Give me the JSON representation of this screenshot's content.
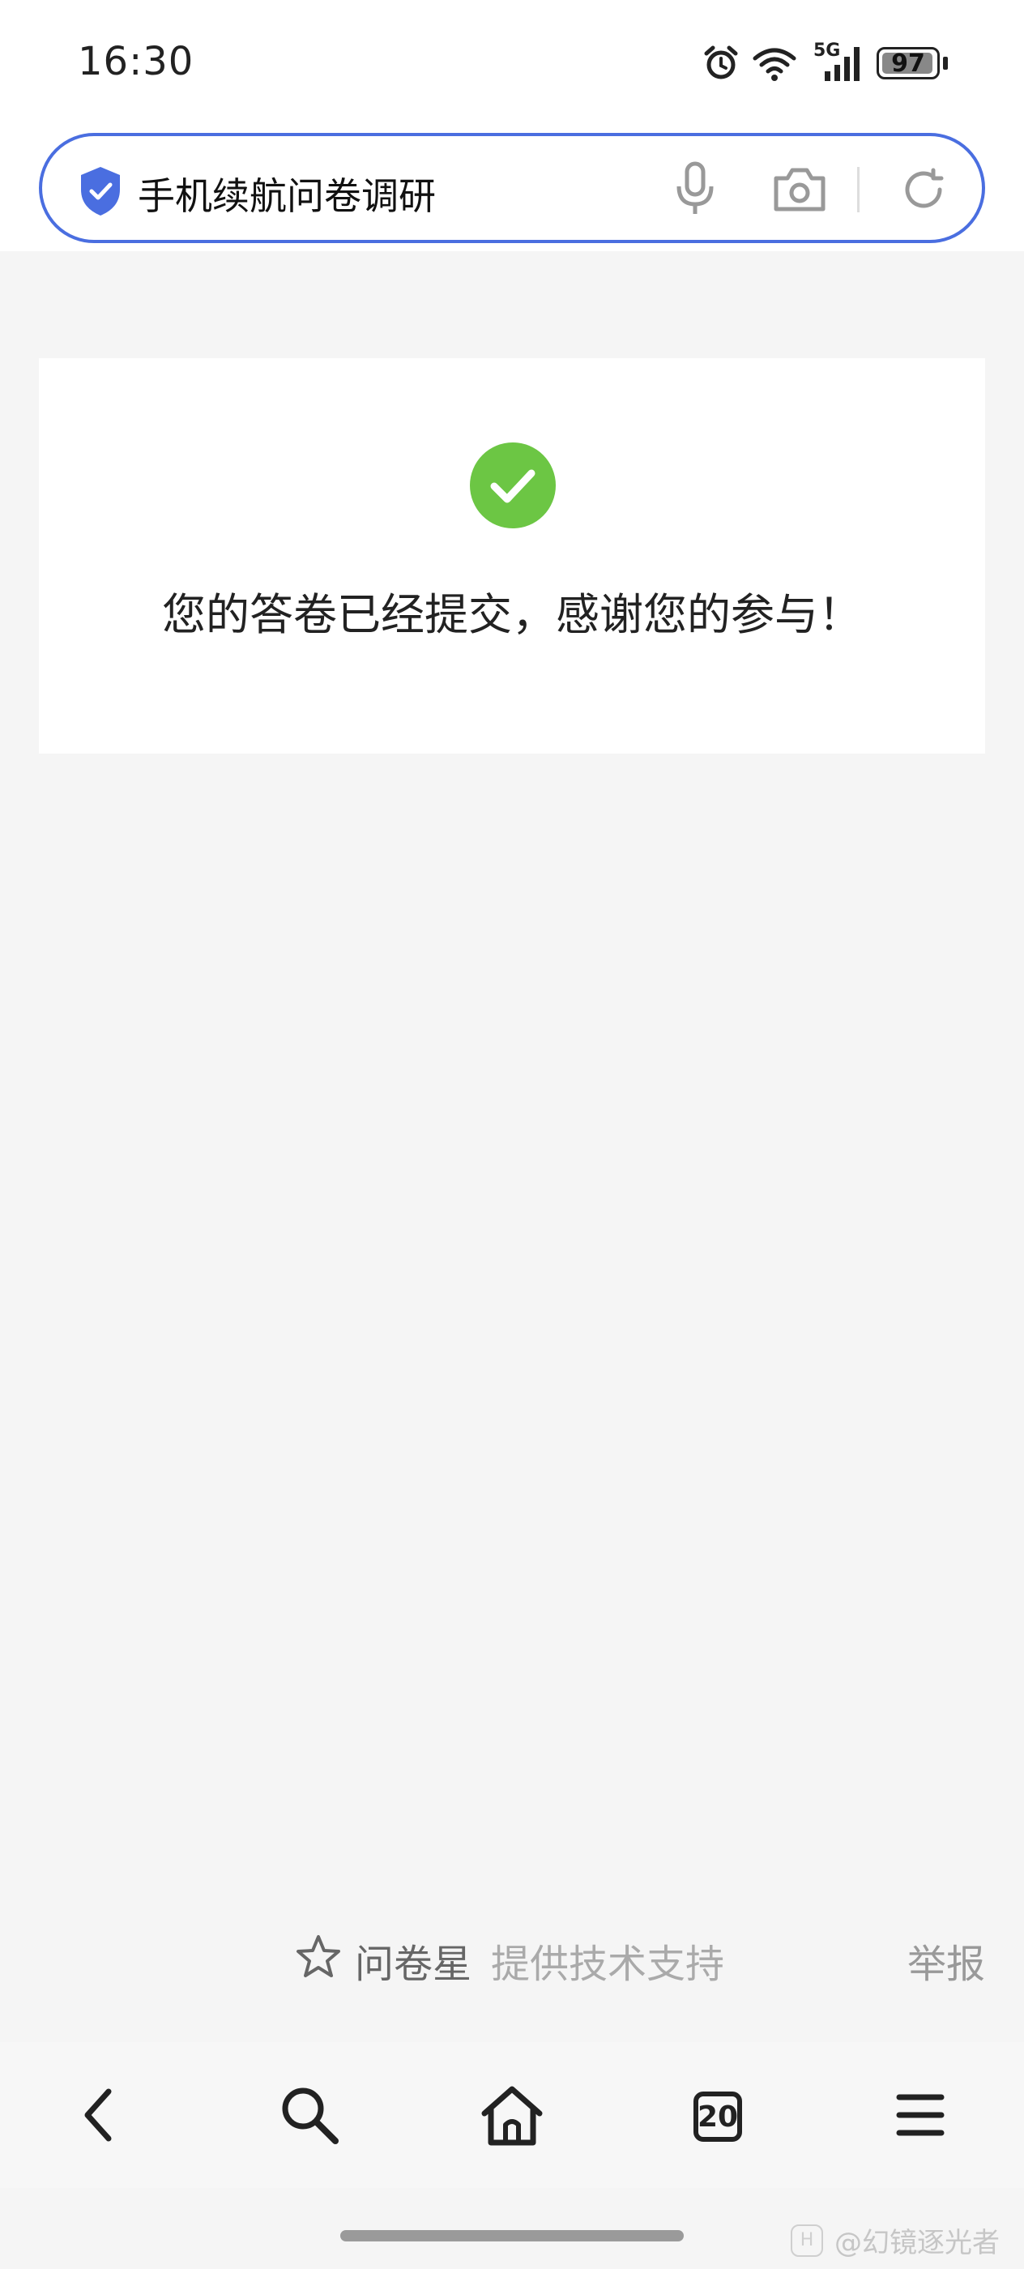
{
  "status_bar": {
    "time": "16:30",
    "network_label": "5G",
    "battery_level": "97",
    "battery_fraction": 0.97,
    "icons": [
      "alarm-icon",
      "wifi-icon",
      "cellular-signal-icon",
      "battery-icon"
    ]
  },
  "search_bar": {
    "query": "手机续航问卷调研",
    "icons": [
      "shield-check-icon",
      "microphone-icon",
      "camera-icon",
      "refresh-icon"
    ],
    "accent_color": "#4a6ee0"
  },
  "result_card": {
    "message": "您的答卷已经提交，感谢您的参与！",
    "icon": "check-circle-icon",
    "icon_color": "#6cc644"
  },
  "footer": {
    "brand": "问卷星",
    "support_text": "提供技术支持",
    "report_label": "举报"
  },
  "bottom_nav": {
    "tab_count": "20",
    "icons": [
      "back-icon",
      "search-icon",
      "home-icon",
      "tabs-icon",
      "menu-icon"
    ]
  },
  "watermark": {
    "text": "@幻镜逐光者"
  }
}
